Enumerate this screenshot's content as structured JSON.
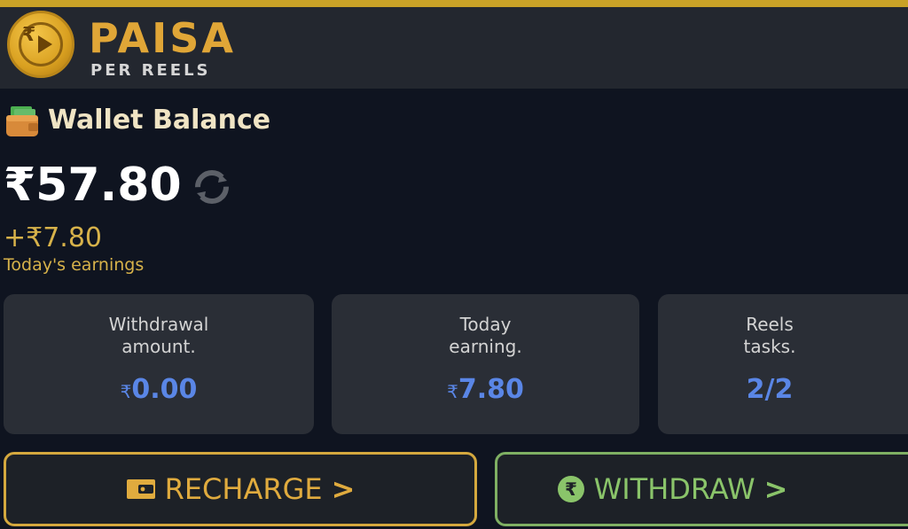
{
  "header": {
    "brand_title": "PAISA",
    "brand_subtitle": "PER REELS"
  },
  "wallet": {
    "title": "Wallet Balance",
    "balance": "₹57.80",
    "today_delta": "+₹7.80",
    "today_label": "Today's earnings"
  },
  "stats": [
    {
      "label": "Withdrawal\namount.",
      "currency": "₹",
      "value": "0.00"
    },
    {
      "label": "Today\nearning.",
      "currency": "₹",
      "value": "7.80"
    },
    {
      "label": "Reels\ntasks.",
      "currency": "",
      "value": "2/2"
    }
  ],
  "actions": {
    "recharge_label": "RECHARGE",
    "withdraw_label": "WITHDRAW"
  },
  "icons": {
    "logo": "coin-logo-icon",
    "wallet": "wallet-icon",
    "refresh": "refresh-icon",
    "recharge": "wallet-card-icon",
    "withdraw": "rupee-circle-icon",
    "chevron": "chevron-right-icon"
  },
  "colors": {
    "accent_gold": "#d4a83e",
    "accent_green": "#7fb063",
    "value_blue": "#5a86e6",
    "background": "#0f1420",
    "card": "#2a2e36"
  }
}
